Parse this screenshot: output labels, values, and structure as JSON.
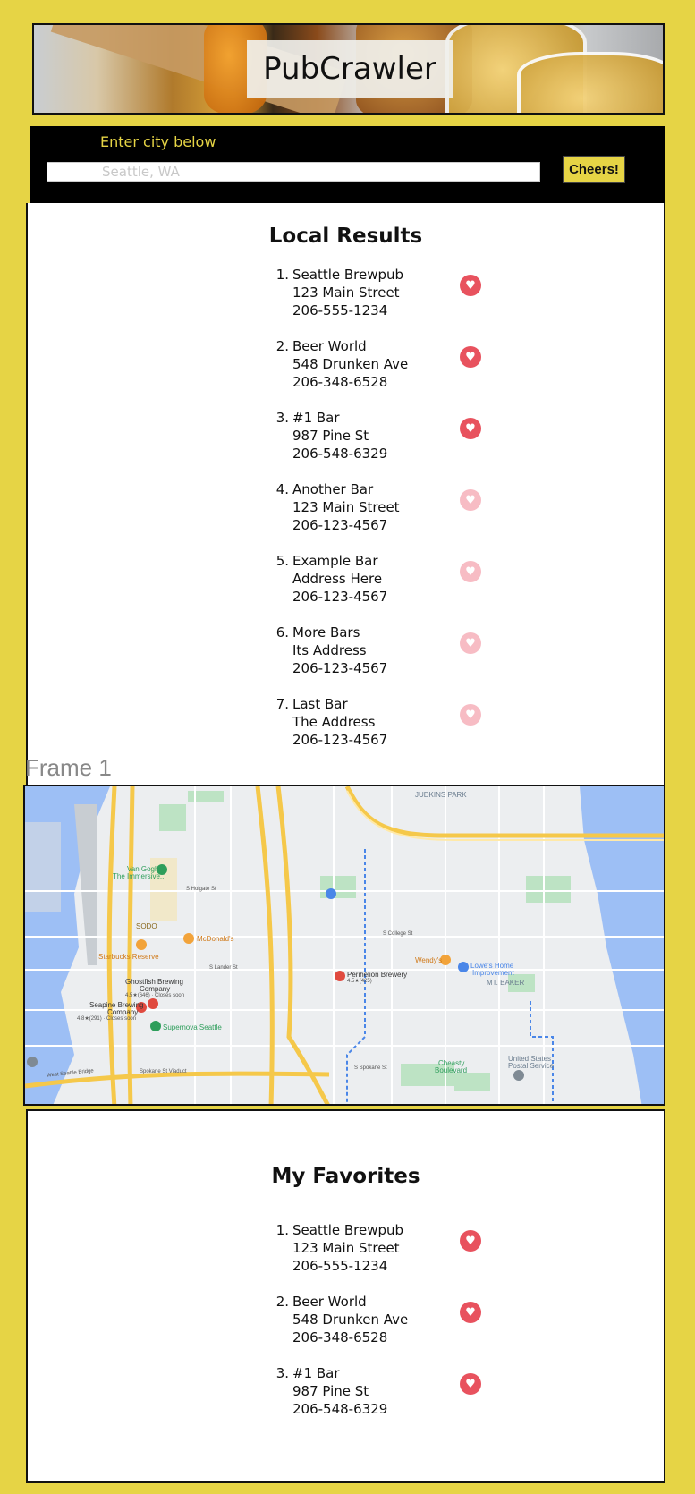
{
  "app": {
    "title": "PubCrawler"
  },
  "search": {
    "label": "Enter city below",
    "placeholder": "Seattle, WA",
    "button_label": "Cheers!"
  },
  "local_results": {
    "title": "Local Results",
    "items": [
      {
        "number": "1.",
        "name": "Seattle Brewpub",
        "address": "123 Main Street",
        "phone": "206-555-1234",
        "favorited": true
      },
      {
        "number": "2.",
        "name": "Beer World",
        "address": "548 Drunken Ave",
        "phone": "206-348-6528",
        "favorited": true
      },
      {
        "number": "3.",
        "name": "#1 Bar",
        "address": "987 Pine St",
        "phone": "206-548-6329",
        "favorited": true
      },
      {
        "number": "4.",
        "name": "Another Bar",
        "address": "123 Main Street",
        "phone": "206-123-4567",
        "favorited": false
      },
      {
        "number": "5.",
        "name": "Example Bar",
        "address": "Address Here",
        "phone": "206-123-4567",
        "favorited": false
      },
      {
        "number": "6.",
        "name": "More Bars",
        "address": "Its Address",
        "phone": "206-123-4567",
        "favorited": false
      },
      {
        "number": "7.",
        "name": "Last Bar",
        "address": "The Address",
        "phone": "206-123-4567",
        "favorited": false
      }
    ]
  },
  "frame_label": "Frame 1",
  "map": {
    "labels": {
      "judkins_park": "JUDKINS PARK",
      "van_gogh": "Van Gogh:",
      "van_gogh_2": "The Immersive...",
      "sodo": "SODO",
      "starbucks": "Starbucks Reserve",
      "mcdonalds": "McDonald's",
      "ghostfish": "Ghostfish Brewing",
      "ghostfish_2": "Company",
      "ghostfish_rating": "4.5★(646) · Closes soon",
      "seapine": "Seapine Brewing",
      "seapine_2": "Company",
      "seapine_rating": "4.8★(291) · Closes soon",
      "supernova": "Supernova Seattle",
      "perihelion": "Perihelion Brewery",
      "perihelion_rating": "4.5★(425)",
      "wendys": "Wendy's",
      "lowes": "Lowe's Home",
      "lowes_2": "Improvement",
      "mt_baker": "MT. BAKER",
      "cheasty": "Cheasty",
      "cheasty_2": "Boulevard",
      "usps": "United States",
      "usps_2": "Postal Service",
      "holgate": "S Holgate St",
      "lander": "S Lander St",
      "college": "S College St",
      "spokane": "Spokane St Viaduct",
      "spokane_2": "S Spokane St",
      "west_seattle_bridge": "West Seattle Bridge"
    },
    "colors": {
      "water": "#9dbff5",
      "park": "#bde3c4",
      "highway": "#f5c84a",
      "land": "#eceef0"
    }
  },
  "favorites": {
    "title": "My Favorites",
    "items": [
      {
        "number": "1.",
        "name": "Seattle Brewpub",
        "address": "123 Main Street",
        "phone": "206-555-1234",
        "favorited": true
      },
      {
        "number": "2.",
        "name": "Beer World",
        "address": "548 Drunken Ave",
        "phone": "206-348-6528",
        "favorited": true
      },
      {
        "number": "3.",
        "name": "#1 Bar",
        "address": "987 Pine St",
        "phone": "206-548-6329",
        "favorited": true
      }
    ]
  },
  "icons": {
    "favorite": "heart-icon",
    "map_pin": "map-pin-icon"
  },
  "colors": {
    "background": "#e6d445",
    "heart_active": "#e8525e",
    "heart_inactive": "#f7bcc4",
    "search_bar": "#000000"
  }
}
